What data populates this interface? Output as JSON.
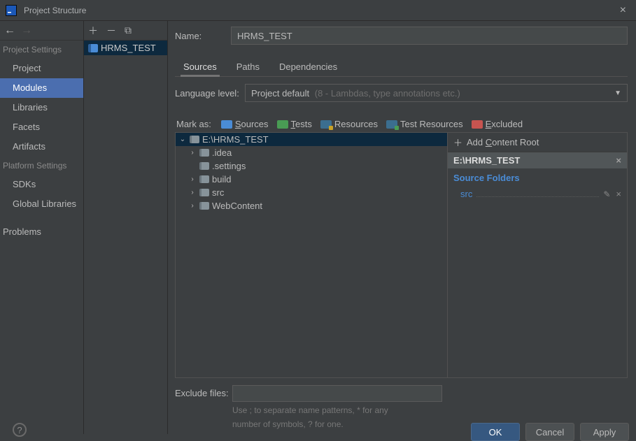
{
  "window": {
    "title": "Project Structure"
  },
  "sidebar": {
    "section1": "Project Settings",
    "items1": [
      "Project",
      "Modules",
      "Libraries",
      "Facets",
      "Artifacts"
    ],
    "section2": "Platform Settings",
    "items2": [
      "SDKs",
      "Global Libraries"
    ],
    "problems": "Problems"
  },
  "modules": {
    "entries": [
      "HRMS_TEST"
    ]
  },
  "form": {
    "name_label": "Name:",
    "name_value": "HRMS_TEST",
    "tabs": [
      "Sources",
      "Paths",
      "Dependencies"
    ],
    "lang_label": "Language level:",
    "lang_value": "Project default",
    "lang_hint": "(8 - Lambdas, type annotations etc.)"
  },
  "mark": {
    "label": "Mark as:",
    "sources": "Sources",
    "tests": "Tests",
    "resources": "Resources",
    "test_resources": "Test Resources",
    "excluded": "Excluded"
  },
  "tree": {
    "root": "E:\\HRMS_TEST",
    "children": [
      ".idea",
      ".settings",
      "build",
      "src",
      "WebContent"
    ]
  },
  "rightPanel": {
    "add": "Add Content Root",
    "root": "E:\\HRMS_TEST",
    "section": "Source Folders",
    "items": [
      "src"
    ]
  },
  "exclude": {
    "label": "Exclude files:",
    "hint1": "Use ; to separate name patterns, * for any",
    "hint2": "number of symbols, ? for one."
  },
  "buttons": {
    "ok": "OK",
    "cancel": "Cancel",
    "apply": "Apply"
  }
}
